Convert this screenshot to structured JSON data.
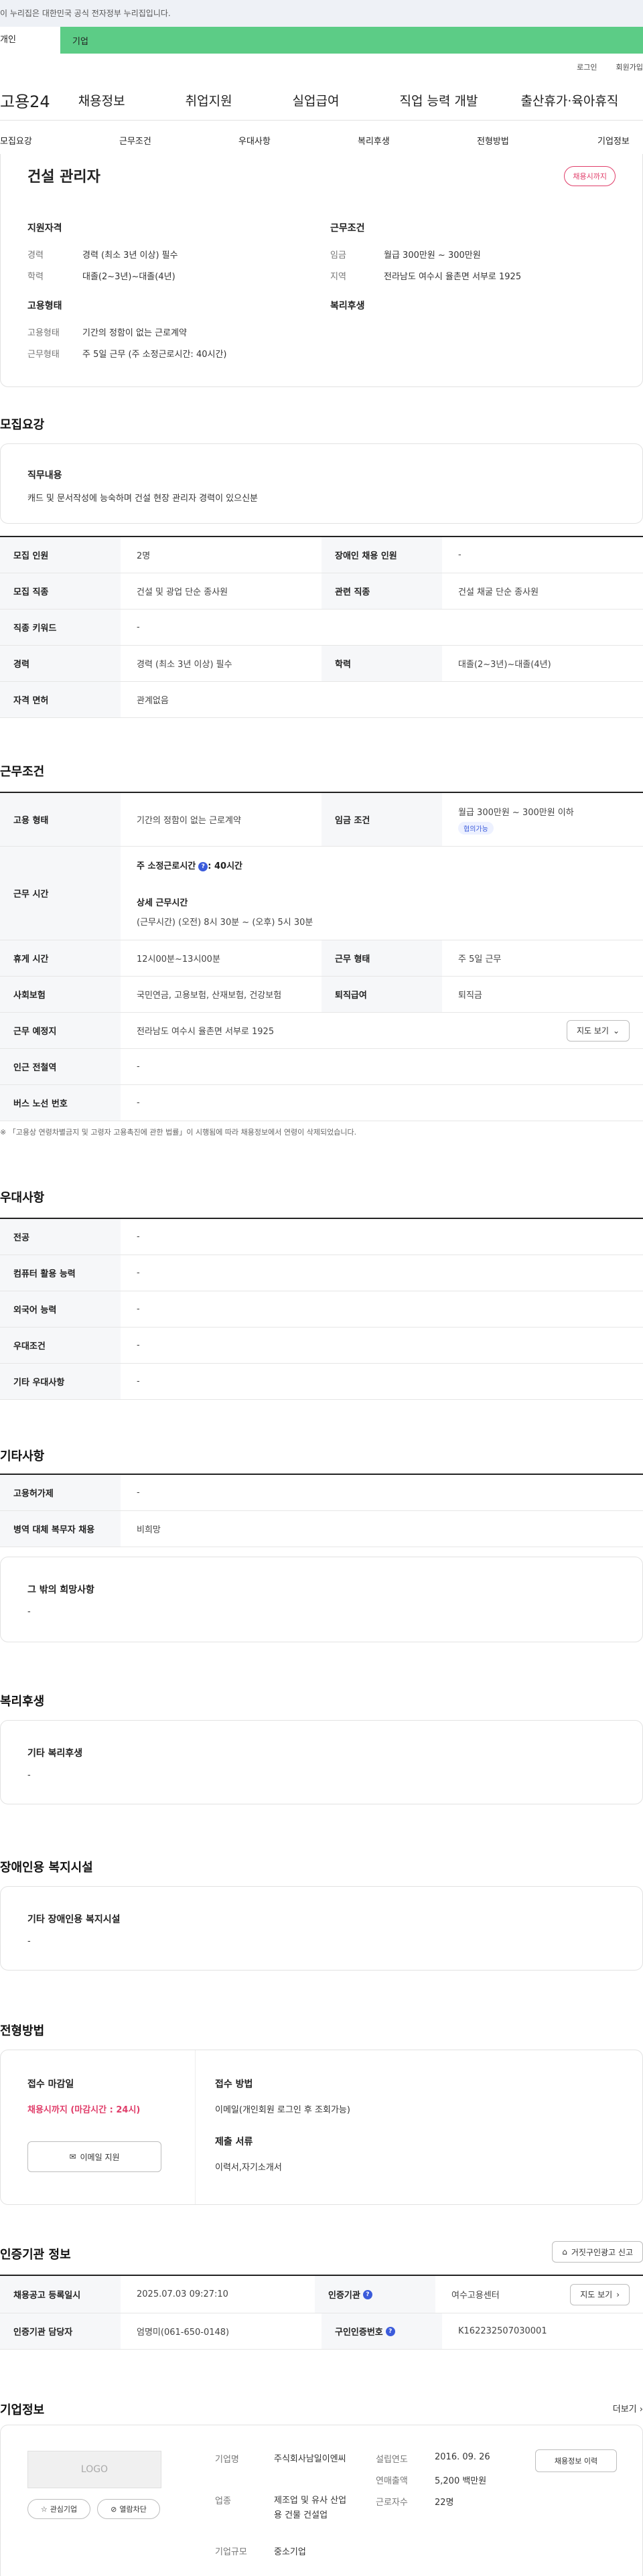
{
  "notice": "이 누리집은 대한민국 공식 전자정부 누리집입니다.",
  "tabs": {
    "individual": "개인",
    "enterprise": "기업"
  },
  "util": {
    "login": "로그인",
    "join": "회원가입"
  },
  "gnb": {
    "logo": "고용24",
    "items": [
      "채용정보",
      "취업지원",
      "실업급여",
      "직업 능력 개발",
      "출산휴가·육아휴직"
    ]
  },
  "subnav": [
    "모집요강",
    "근무조건",
    "우대사항",
    "복리후생",
    "전형방법",
    "기업정보"
  ],
  "summary": {
    "title": "건설 관리자",
    "badge": "채용시까지",
    "qual_head": "지원자격",
    "career_label": "경력",
    "career": "경력 (최소 3년 이상) 필수",
    "edu_label": "학력",
    "edu": "대졸(2~3년)~대졸(4년)",
    "emp_head": "고용형태",
    "emptype_label": "고용형태",
    "emptype": "기간의 정함이 없는 근로계약",
    "worktype_label": "근무형태",
    "worktype": "주 5일 근무 (주 소정근로시간: 40시간)",
    "cond_head": "근무조건",
    "wage_label": "임금",
    "wage": "월급 300만원 ~ 300만원",
    "region_label": "지역",
    "region": "전라남도 여수시 율촌면 서부로 1925",
    "welfare_head": "복리후생"
  },
  "recruit": {
    "title": "모집요강",
    "duty_head": "직무내용",
    "duty": "캐드 및 문서작성에 능숙하며 건설 현장 관리자 경력이 있으신분",
    "rows": [
      {
        "h1": "모집 인원",
        "v1": "2명",
        "h2": "장애인 채용 인원",
        "v2": "-"
      },
      {
        "h1": "모집 직종",
        "v1": "건설 및 광업 단순 종사원",
        "h2": "관련 직종",
        "v2": "건설 채굴 단순 종사원"
      },
      {
        "h1": "직종 키워드",
        "v1": "-"
      },
      {
        "h1": "경력",
        "v1": "경력 (최소 3년 이상) 필수",
        "h2": "학력",
        "v2": "대졸(2~3년)~대졸(4년)"
      },
      {
        "h1": "자격 면허",
        "v1": "관계없음"
      }
    ]
  },
  "work": {
    "title": "근무조건",
    "emptype_h": "고용 형태",
    "emptype": "기간의 정함이 없는 근로계약",
    "wage_h": "임금 조건",
    "wage": "월급 300만원 ~ 300만원 이하",
    "wage_badge": "협의가능",
    "time_h": "근무 시간",
    "hours_label": "주 소정근로시간",
    "hours": ": 40시간",
    "detail_label": "상세 근무시간",
    "detail": "(근무시간) (오전) 8시 30분 ~ (오후) 5시 30분",
    "rest_h": "휴게 시간",
    "rest": "12시00분~13시00분",
    "form_h": "근무 형태",
    "form": "주 5일 근무",
    "ins_h": "사회보험",
    "ins": "국민연금, 고용보험, 산재보험, 건강보험",
    "sev_h": "퇴직급여",
    "sev": "퇴직금",
    "place_h": "근무 예정지",
    "place": "전라남도 여수시 율촌면 서부로 1925",
    "map_btn": "지도 보기",
    "station_h": "인근 전철역",
    "station": "-",
    "bus_h": "버스 노선 번호",
    "bus": "-",
    "note": "※ 「고용상 연령차별금지 및 고령자 고용촉진에 관한 법률」이 시행됨에 따라 채용정보에서 연령이 삭제되었습니다."
  },
  "pref": {
    "title": "우대사항",
    "rows": [
      {
        "h": "전공",
        "v": "-"
      },
      {
        "h": "컴퓨터 활용 능력",
        "v": "-"
      },
      {
        "h": "외국어 능력",
        "v": "-"
      },
      {
        "h": "우대조건",
        "v": "-"
      },
      {
        "h": "기타 우대사항",
        "v": "-"
      }
    ]
  },
  "etc": {
    "title": "기타사항",
    "rows": [
      {
        "h": "고용허가제",
        "v": "-"
      },
      {
        "h": "병역 대체 복무자 채용",
        "v": "비희망"
      }
    ],
    "hope_head": "그 밖의 희망사항",
    "hope": "-"
  },
  "welfare": {
    "title": "복리후생",
    "head": "기타 복리후생",
    "val": "-"
  },
  "disabled": {
    "title": "장애인용 복지시설",
    "head": "기타 장애인용 복지시설",
    "val": "-"
  },
  "selection": {
    "title": "전형방법",
    "deadline_h": "접수 마감일",
    "deadline": "채용시까지 (마감시간 : 24시)",
    "email_btn": "이메일 지원",
    "method_h": "접수 방법",
    "method": "이메일(개인회원 로그인 후 조회가능)",
    "docs_h": "제출 서류",
    "docs": "이력서,자기소개서"
  },
  "agency": {
    "title": "인증기관 정보",
    "report_btn": "거짓구인광고 신고",
    "reg_h": "채용공고 등록일시",
    "reg": "2025.07.03 09:27:10",
    "org_h": "인증기관",
    "org": "여수고용센터",
    "map_btn": "지도 보기",
    "mgr_h": "인증기관 담당자",
    "mgr": "엄명미(061-650-0148)",
    "no_h": "구인인증번호",
    "no": "K162232507030001"
  },
  "company": {
    "title": "기업정보",
    "more": "더보기",
    "logo": "LOGO",
    "interest": "관심기업",
    "block": "열람차단",
    "name_l": "기업명",
    "name": "주식회사남일이엔씨",
    "ind_l": "업종",
    "ind": "제조업 및 유사 산업용 건물 건설업",
    "scale_l": "기업규모",
    "scale": "중소기업",
    "est_l": "설립연도",
    "est": "2016. 09. 26",
    "sales_l": "연매출액",
    "sales": "5,200 백만원",
    "emp_l": "근로자수",
    "emp": "22명",
    "list_btn": "채용정보 이력"
  }
}
